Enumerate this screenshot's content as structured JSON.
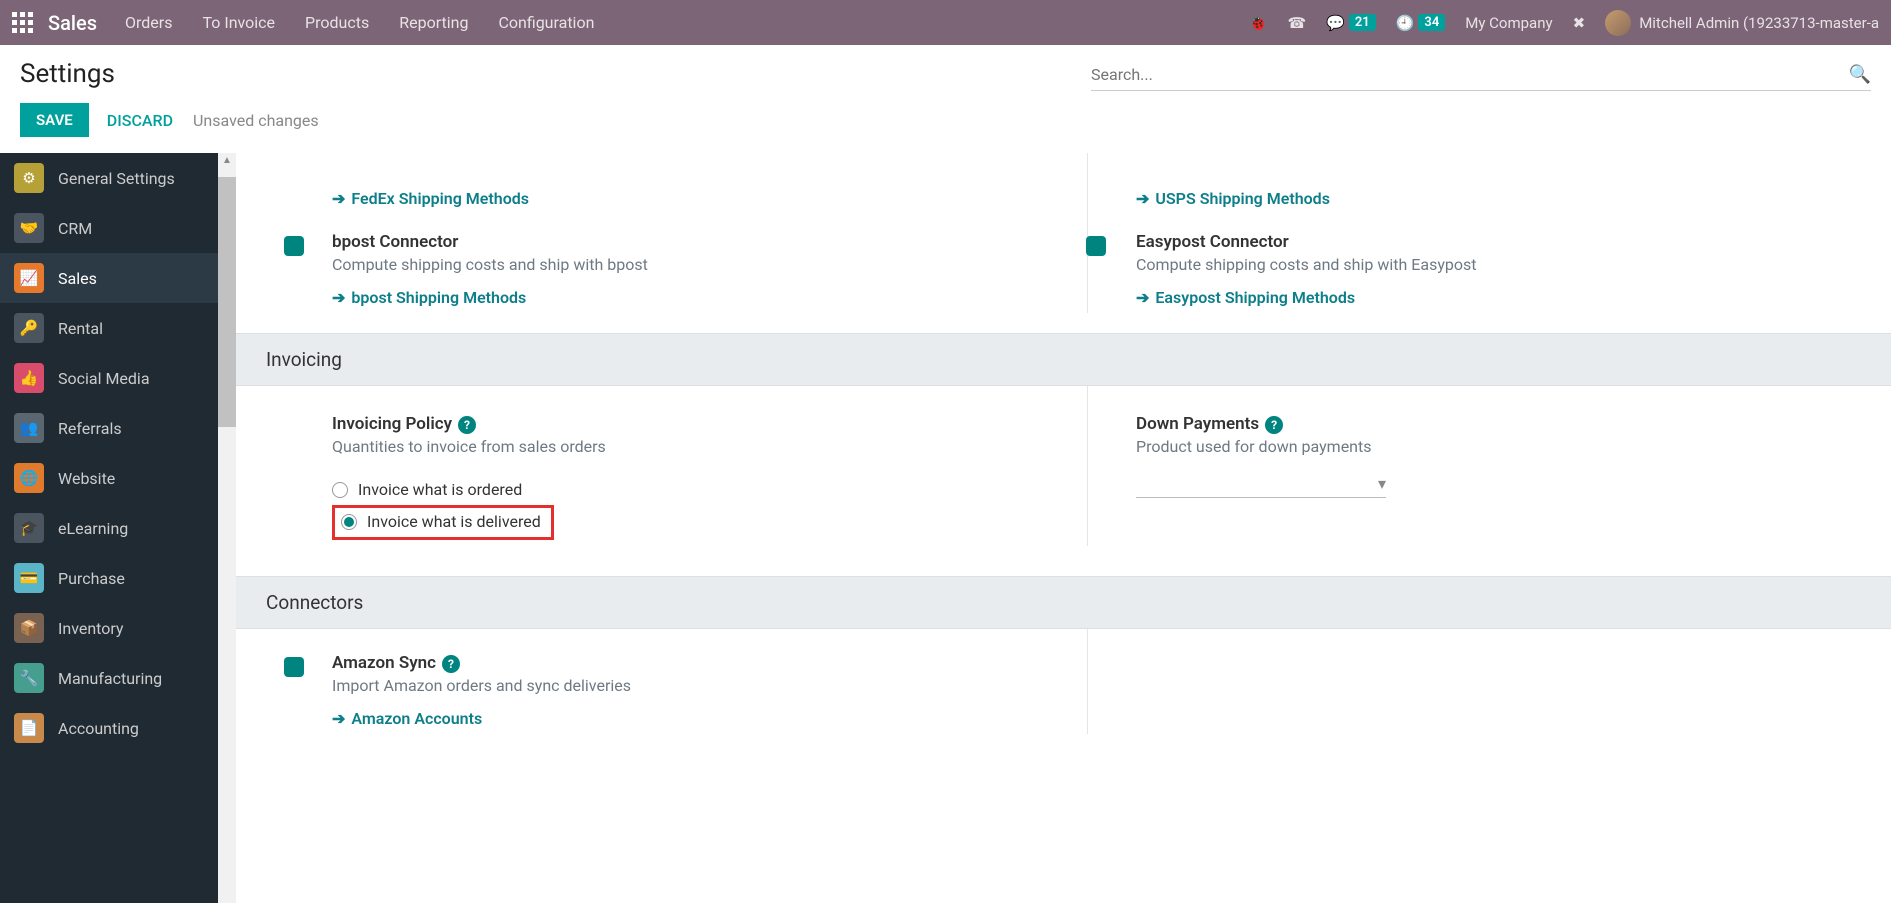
{
  "topbar": {
    "brand": "Sales",
    "nav": [
      "Orders",
      "To Invoice",
      "Products",
      "Reporting",
      "Configuration"
    ],
    "msg_count": "21",
    "activity_count": "34",
    "company": "My Company",
    "user": "Mitchell Admin (19233713-master-a"
  },
  "header": {
    "title": "Settings",
    "search_placeholder": "Search..."
  },
  "actions": {
    "save": "SAVE",
    "discard": "DISCARD",
    "dirty": "Unsaved changes"
  },
  "sidebar": [
    {
      "label": "General Settings",
      "icon": "⚙",
      "cls": "ic-general"
    },
    {
      "label": "CRM",
      "icon": "🤝",
      "cls": "ic-crm"
    },
    {
      "label": "Sales",
      "icon": "📈",
      "cls": "ic-sales",
      "active": true
    },
    {
      "label": "Rental",
      "icon": "🔑",
      "cls": "ic-rental"
    },
    {
      "label": "Social Media",
      "icon": "👍",
      "cls": "ic-social"
    },
    {
      "label": "Referrals",
      "icon": "👥",
      "cls": "ic-referrals"
    },
    {
      "label": "Website",
      "icon": "🌐",
      "cls": "ic-website"
    },
    {
      "label": "eLearning",
      "icon": "🎓",
      "cls": "ic-elearning"
    },
    {
      "label": "Purchase",
      "icon": "💳",
      "cls": "ic-purchase"
    },
    {
      "label": "Inventory",
      "icon": "📦",
      "cls": "ic-inventory"
    },
    {
      "label": "Manufacturing",
      "icon": "🔧",
      "cls": "ic-mfg"
    },
    {
      "label": "Accounting",
      "icon": "📄",
      "cls": "ic-acct"
    }
  ],
  "shipping": {
    "fedex_link": "FedEx Shipping Methods",
    "usps_link": "USPS Shipping Methods",
    "bpost_title": "bpost Connector",
    "bpost_desc": "Compute shipping costs and ship with bpost",
    "bpost_link": "bpost Shipping Methods",
    "easypost_title": "Easypost Connector",
    "easypost_desc": "Compute shipping costs and ship with Easypost",
    "easypost_link": "Easypost Shipping Methods"
  },
  "invoicing": {
    "section": "Invoicing",
    "policy_title": "Invoicing Policy",
    "policy_desc": "Quantities to invoice from sales orders",
    "opt_ordered": "Invoice what is ordered",
    "opt_delivered": "Invoice what is delivered",
    "down_title": "Down Payments",
    "down_desc": "Product used for down payments"
  },
  "connectors": {
    "section": "Connectors",
    "amazon_title": "Amazon Sync",
    "amazon_desc": "Import Amazon orders and sync deliveries",
    "amazon_link": "Amazon Accounts"
  }
}
